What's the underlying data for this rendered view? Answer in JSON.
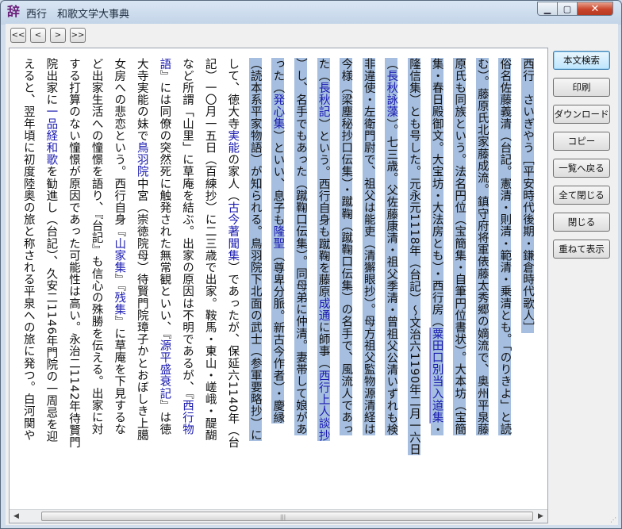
{
  "window": {
    "app_icon_glyph": "辞",
    "title": "西行　和歌文学大事典",
    "min_glyph": "▁",
    "max_glyph": "▢",
    "close_glyph": "✕"
  },
  "nav": {
    "first": "<<",
    "prev": "<",
    "next": ">",
    "last": ">>"
  },
  "sidebar": {
    "buttons": [
      "本文検索",
      "印刷",
      "ダウンロード",
      "コピー",
      "一覧へ戻る",
      "全て閉じる",
      "閉じる",
      "重ねて表示"
    ]
  },
  "article": {
    "columns": [
      [
        {
          "t": "西行　さいぎやう［平安時代後期・鎌倉時代歌人］",
          "s": 1
        }
      ],
      [
        {
          "t": "俗名佐藤義清（台記。憲清・則清・範清・乗清とも。「のりきよ」と読",
          "s": 1
        }
      ],
      [
        {
          "t": "む）。藤原氏北家藤成流。鎮守府将軍俵藤太秀郷の嫡流で、奥州平泉藤",
          "s": 1
        }
      ],
      [
        {
          "t": "原氏も同族という。法名円位（宝簡集・自筆円位書状）。大本坊（宝簡",
          "s": 1
        }
      ],
      [
        {
          "t": "集・春日殿御文。大宝坊・大法房とも）・西行房（",
          "s": 1
        },
        {
          "t": "粟田口別当入道集",
          "s": 1,
          "l": "lnk u"
        },
        {
          "t": "・",
          "s": 1
        }
      ],
      [
        {
          "t": "隆信集）とも号した。元永元1118年（台記）〜文治六1190年二月一六日",
          "s": 1
        }
      ],
      [
        {
          "t": "（",
          "s": 1
        },
        {
          "t": "長秋詠藻",
          "s": 1,
          "l": "lnk"
        },
        {
          "t": "）。七三歳。父佐藤康清・祖父季清・曾祖父公清いずれも検",
          "s": 1
        }
      ],
      [
        {
          "t": "非違使・左衛門尉で、祖父は能吏（清獬眼抄）。母方祖父監物源清経は",
          "s": 1
        }
      ],
      [
        {
          "t": "今様（梁塵秘抄口伝集）・蹴鞠（蹴鞠口伝集）の名手で、風流人であっ",
          "s": 1
        }
      ],
      [
        {
          "t": "た（",
          "s": 1
        },
        {
          "t": "長秋記",
          "s": 1,
          "l": "lnk"
        },
        {
          "t": "）という。西行自身も蹴鞠を藤原",
          "s": 1
        },
        {
          "t": "成通",
          "s": 1,
          "l": "lnk"
        },
        {
          "t": "に師事（",
          "s": 1
        },
        {
          "t": "西行上人談抄",
          "s": 1,
          "l": "lnk"
        }
      ],
      [
        {
          "t": "）し、名手でもあった（蹴鞠口伝集）。同母弟に仲清。妻帯して娘があ",
          "s": 1
        }
      ],
      [
        {
          "t": "った（",
          "s": 1
        },
        {
          "t": "発心集",
          "s": 1,
          "l": "lnk"
        },
        {
          "t": "）といい、息子も",
          "s": 1
        },
        {
          "t": "隆聖",
          "s": 1,
          "l": "lnk"
        },
        {
          "t": "（尊卑分脈。新古今作者）・慶縁",
          "s": 1
        }
      ],
      [
        {
          "t": "（読本系平家物語）が知られる。鳥羽院下北面の武士（参軍要略抄）に",
          "s": 1
        }
      ],
      [
        {
          "t": "して、徳大寺",
          "s": 0
        },
        {
          "t": "実能",
          "s": 0,
          "l": "lnk"
        },
        {
          "t": "の家人（",
          "s": 0
        },
        {
          "t": "古今著聞集",
          "s": 0,
          "l": "lnk"
        },
        {
          "t": "）であったが、保延六1140年（台",
          "s": 0
        }
      ],
      [
        {
          "t": "記）一〇月一五日（百練抄）に二三歳で出家。鞍馬・東山・嵯峨・醍醐",
          "s": 0
        }
      ],
      [
        {
          "t": "など所謂「山里」に草庵を結ぶ。出家の原因は不明であるが、『",
          "s": 0
        },
        {
          "t": "西行物",
          "s": 0,
          "l": "lnk"
        }
      ],
      [
        {
          "t": "語",
          "s": 0,
          "l": "lnk"
        },
        {
          "t": "』には同僚の突然死に触発された無常観といい、『",
          "s": 0
        },
        {
          "t": "源平盛衰記",
          "s": 0,
          "l": "lnk"
        },
        {
          "t": "』は徳",
          "s": 0
        }
      ],
      [
        {
          "t": "大寺実能の妹で",
          "s": 0
        },
        {
          "t": "鳥羽院",
          "s": 0,
          "l": "lnk"
        },
        {
          "t": "中宮（崇徳院母）待賢門院璋子かとおぼしき上臈",
          "s": 0
        }
      ],
      [
        {
          "t": "女房への悲恋という。西行自身『",
          "s": 0
        },
        {
          "t": "山家集",
          "s": 0,
          "l": "lnk"
        },
        {
          "t": "』『",
          "s": 0
        },
        {
          "t": "残集",
          "s": 0,
          "l": "lnk"
        },
        {
          "t": "』に草庵を下見するな",
          "s": 0
        }
      ],
      [
        {
          "t": "ど出家生活への憧憬を語り、『台記』も信心の殊勝を伝える。出家に対",
          "s": 0
        }
      ],
      [
        {
          "t": "する打算のない憧憬が原因であった可能性は高い。永治二1142年待賢門",
          "s": 0
        }
      ],
      [
        {
          "t": "院出家に",
          "s": 0
        },
        {
          "t": "一品経和歌",
          "s": 0,
          "l": "lnk"
        },
        {
          "t": "を勧進し（台記）、久安二1146年門院の一周忌を迎",
          "s": 0
        }
      ],
      [
        {
          "t": "えると、翌年頃に初度陸奥の旅と称される平泉への旅に発つ。白河関や",
          "s": 0
        }
      ]
    ]
  }
}
